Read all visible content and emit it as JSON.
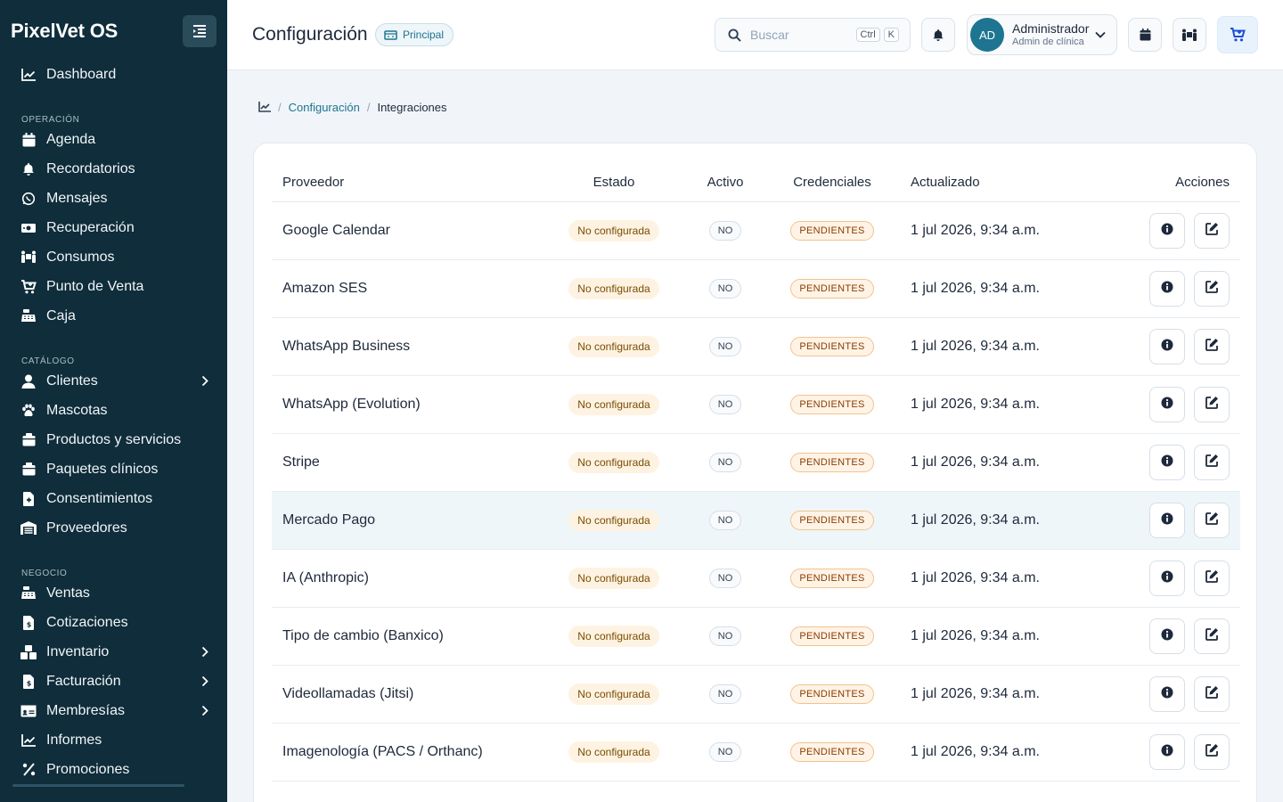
{
  "app": {
    "brand": "PixelVet OS"
  },
  "sidebar": {
    "items_top": [
      {
        "label": "Dashboard",
        "icon": "chart-line-icon"
      }
    ],
    "sections": [
      {
        "title": "OPERACIÓN",
        "items": [
          {
            "label": "Agenda",
            "icon": "calendar-icon",
            "chevron": false
          },
          {
            "label": "Recordatorios",
            "icon": "bell-icon",
            "chevron": false
          },
          {
            "label": "Mensajes",
            "icon": "whatsapp-icon",
            "chevron": false
          },
          {
            "label": "Recuperación",
            "icon": "money-icon",
            "chevron": false
          },
          {
            "label": "Consumos",
            "icon": "people-carry-icon",
            "chevron": false
          },
          {
            "label": "Punto de Venta",
            "icon": "cart-icon",
            "chevron": false
          },
          {
            "label": "Caja",
            "icon": "cash-register-icon",
            "chevron": false
          }
        ]
      },
      {
        "title": "CATÁLOGO",
        "items": [
          {
            "label": "Clientes",
            "icon": "user-icon",
            "chevron": true
          },
          {
            "label": "Mascotas",
            "icon": "paw-icon",
            "chevron": false
          },
          {
            "label": "Productos y servicios",
            "icon": "box-icon",
            "chevron": false
          },
          {
            "label": "Paquetes clínicos",
            "icon": "box-icon",
            "chevron": false
          },
          {
            "label": "Consentimientos",
            "icon": "file-medical-icon",
            "chevron": false
          },
          {
            "label": "Proveedores",
            "icon": "warehouse-icon",
            "chevron": false
          }
        ]
      },
      {
        "title": "NEGOCIO",
        "items": [
          {
            "label": "Ventas",
            "icon": "cash-register-icon",
            "chevron": false
          },
          {
            "label": "Cotizaciones",
            "icon": "file-invoice-dollar-icon",
            "chevron": false
          },
          {
            "label": "Inventario",
            "icon": "boxes-icon",
            "chevron": true
          },
          {
            "label": "Facturación",
            "icon": "file-invoice-dollar-icon",
            "chevron": true
          },
          {
            "label": "Membresías",
            "icon": "id-card-icon",
            "chevron": true
          },
          {
            "label": "Informes",
            "icon": "chart-line-icon",
            "chevron": false
          },
          {
            "label": "Promociones",
            "icon": "percent-icon",
            "chevron": false
          }
        ]
      }
    ]
  },
  "header": {
    "title": "Configuración",
    "branch_badge": "Principal",
    "search_placeholder": "Buscar",
    "shortcut_keys": [
      "Ctrl",
      "K"
    ],
    "user": {
      "initials": "AD",
      "name": "Administrador",
      "role": "Admin de clínica"
    }
  },
  "breadcrumb": {
    "parent": "Configuración",
    "current": "Integraciones"
  },
  "table": {
    "columns": [
      "Proveedor",
      "Estado",
      "Activo",
      "Credenciales",
      "Actualizado",
      "Acciones"
    ],
    "rows": [
      {
        "proveedor": "Google Calendar",
        "estado": "No configurada",
        "activo": "NO",
        "credenciales": "PENDIENTES",
        "actualizado": "1 jul 2026, 9:34 a.m."
      },
      {
        "proveedor": "Amazon SES",
        "estado": "No configurada",
        "activo": "NO",
        "credenciales": "PENDIENTES",
        "actualizado": "1 jul 2026, 9:34 a.m."
      },
      {
        "proveedor": "WhatsApp Business",
        "estado": "No configurada",
        "activo": "NO",
        "credenciales": "PENDIENTES",
        "actualizado": "1 jul 2026, 9:34 a.m."
      },
      {
        "proveedor": "WhatsApp (Evolution)",
        "estado": "No configurada",
        "activo": "NO",
        "credenciales": "PENDIENTES",
        "actualizado": "1 jul 2026, 9:34 a.m."
      },
      {
        "proveedor": "Stripe",
        "estado": "No configurada",
        "activo": "NO",
        "credenciales": "PENDIENTES",
        "actualizado": "1 jul 2026, 9:34 a.m."
      },
      {
        "proveedor": "Mercado Pago",
        "estado": "No configurada",
        "activo": "NO",
        "credenciales": "PENDIENTES",
        "actualizado": "1 jul 2026, 9:34 a.m.",
        "highlighted": true
      },
      {
        "proveedor": "IA (Anthropic)",
        "estado": "No configurada",
        "activo": "NO",
        "credenciales": "PENDIENTES",
        "actualizado": "1 jul 2026, 9:34 a.m."
      },
      {
        "proveedor": "Tipo de cambio (Banxico)",
        "estado": "No configurada",
        "activo": "NO",
        "credenciales": "PENDIENTES",
        "actualizado": "1 jul 2026, 9:34 a.m."
      },
      {
        "proveedor": "Videollamadas (Jitsi)",
        "estado": "No configurada",
        "activo": "NO",
        "credenciales": "PENDIENTES",
        "actualizado": "1 jul 2026, 9:34 a.m."
      },
      {
        "proveedor": "Imagenología (PACS / Orthanc)",
        "estado": "No configurada",
        "activo": "NO",
        "credenciales": "PENDIENTES",
        "actualizado": "1 jul 2026, 9:34 a.m."
      }
    ]
  },
  "colors": {
    "sidebar_bg": "#0f2d3a",
    "accent": "#1d7591",
    "warning_badge_bg": "#fef3e2",
    "highlight_row": "#eef6f9"
  }
}
